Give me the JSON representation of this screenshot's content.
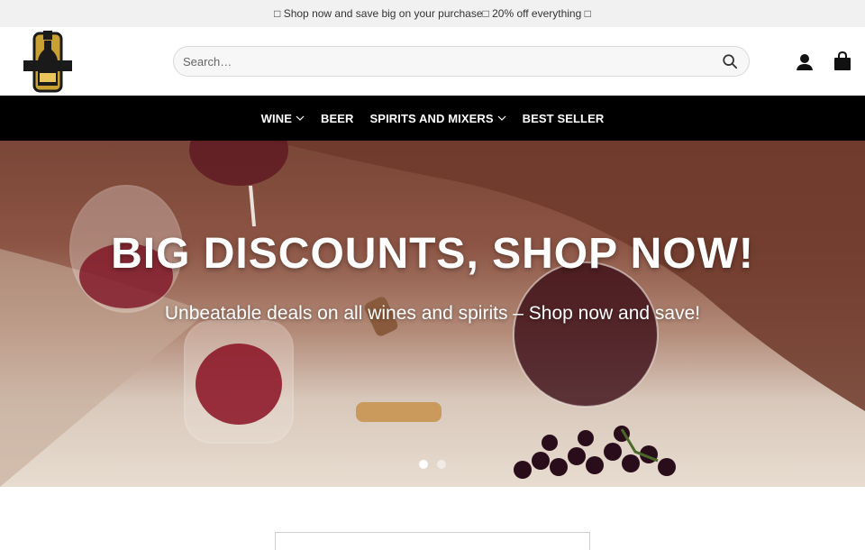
{
  "promo": {
    "text": "□ Shop now and save big on your purchase□ 20% off everything □"
  },
  "header": {
    "logo_name": "bottle-logo",
    "search": {
      "placeholder": "Search…",
      "value": ""
    },
    "icons": [
      "search-icon",
      "account-icon",
      "cart-icon"
    ]
  },
  "nav": {
    "items": [
      {
        "label": "WINE",
        "has_dropdown": true
      },
      {
        "label": "BEER",
        "has_dropdown": false
      },
      {
        "label": "SPIRITS AND MIXERS",
        "has_dropdown": true
      },
      {
        "label": "BEST SELLER",
        "has_dropdown": false
      }
    ]
  },
  "hero": {
    "title": "BIG DISCOUNTS, SHOP NOW!",
    "subtitle": "Unbeatable deals on all wines and spirits – Shop now and save!",
    "slides": 2,
    "active_slide": 1
  },
  "colors": {
    "nav_bg": "#000000",
    "promo_bg": "#f1f1f1",
    "logo_gold": "#c9a133"
  }
}
